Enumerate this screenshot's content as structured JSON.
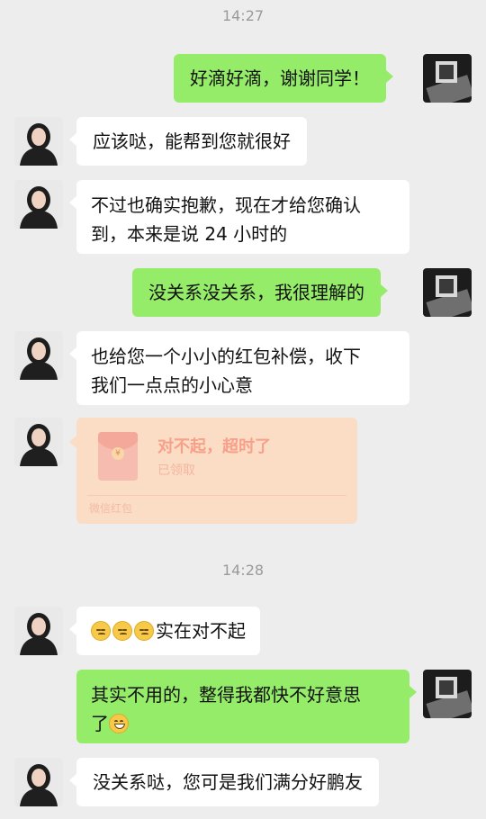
{
  "chat": {
    "timestamps": [
      "14:27",
      "14:28"
    ],
    "messages": [
      {
        "from": "me",
        "text": "好滴好滴，谢谢同学！"
      },
      {
        "from": "other",
        "text": "应该哒，能帮到您就很好"
      },
      {
        "from": "other",
        "line1": "不过也确实抱歉，现在才给您确认",
        "line2": "到，本来是说 24 小时的"
      },
      {
        "from": "me",
        "text": "没关系没关系，我很理解的"
      },
      {
        "from": "other",
        "line1": "也给您一个小小的红包补偿，收下",
        "line2": "我们一点点的小心意"
      },
      {
        "from": "other",
        "emoji_names": [
          "pensive-face",
          "pensive-face",
          "pensive-face"
        ],
        "text": "实在对不起"
      },
      {
        "from": "me",
        "line1": "其实不用的，整得我都快不好意思",
        "line2": "了",
        "emoji_name": "grinning-face"
      },
      {
        "from": "other",
        "text": "没关系哒，您可是我们满分好鹏友"
      }
    ],
    "red_packet": {
      "title": "对不起，超时了",
      "status": "已领取",
      "footer": "微信红包",
      "seal": "¥",
      "color": "#fbdcc5"
    }
  },
  "colors": {
    "background": "#ededed",
    "incoming_bubble": "#ffffff",
    "outgoing_bubble": "#95ec69",
    "timestamp_text": "#9a9a9a"
  }
}
